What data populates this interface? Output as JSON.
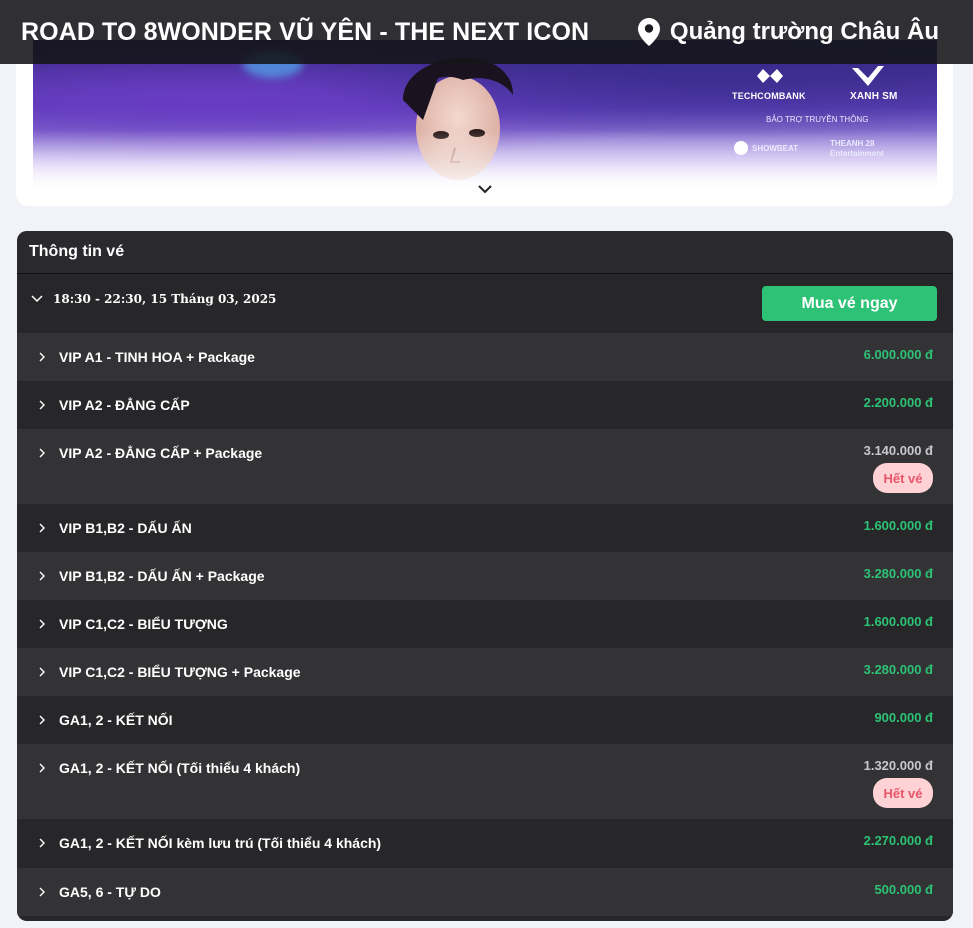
{
  "header": {
    "title": "ROAD TO 8WONDER VŨ YÊN - THE NEXT ICON",
    "location": "Quảng trường Châu Âu"
  },
  "banner": {
    "sponsor_1": "TECHCOMBANK",
    "sponsor_2": "XANH SM",
    "media_label": "BẢO TRỢ TRUYỀN THÔNG",
    "media_1": "SHOWBEAT",
    "media_2": "THEANH 28 Entertainment"
  },
  "tickets_section": {
    "heading": "Thông tin vé",
    "datetime": "18:30 - 22:30, 15 Tháng 03, 2025",
    "buy_label": "Mua vé ngay",
    "sold_out_label": "Hết vé",
    "items": [
      {
        "name": "VIP A1 - TINH HOA + Package",
        "price": "6.000.000 đ",
        "sold_out": false
      },
      {
        "name": "VIP A2 - ĐẲNG CẤP",
        "price": "2.200.000 đ",
        "sold_out": false
      },
      {
        "name": "VIP A2 - ĐẲNG CẤP + Package",
        "price": "3.140.000 đ",
        "sold_out": true
      },
      {
        "name": "VIP B1,B2 - DẤU ẤN",
        "price": "1.600.000 đ",
        "sold_out": false
      },
      {
        "name": "VIP B1,B2 - DẤU ẤN + Package",
        "price": "3.280.000 đ",
        "sold_out": false
      },
      {
        "name": "VIP C1,C2 - BIỂU TƯỢNG",
        "price": "1.600.000 đ",
        "sold_out": false
      },
      {
        "name": "VIP C1,C2 - BIỂU TƯỢNG + Package",
        "price": "3.280.000 đ",
        "sold_out": false
      },
      {
        "name": "GA1, 2 - KẾT NỐI",
        "price": "900.000 đ",
        "sold_out": false
      },
      {
        "name": "GA1, 2 - KẾT NỐI (Tối thiểu 4 khách)",
        "price": "1.320.000 đ",
        "sold_out": true
      },
      {
        "name": "GA1, 2 - KẾT NỐI kèm lưu trú (Tối thiểu 4 khách)",
        "price": "2.270.000 đ",
        "sold_out": false
      },
      {
        "name": "GA5, 6 - TỰ DO",
        "price": "500.000 đ",
        "sold_out": false
      }
    ]
  },
  "colors": {
    "accent_green": "#2dc275",
    "sold_out_bg": "#ffd2d6",
    "sold_out_text": "#e8566a",
    "panel_bg": "#27272a"
  }
}
